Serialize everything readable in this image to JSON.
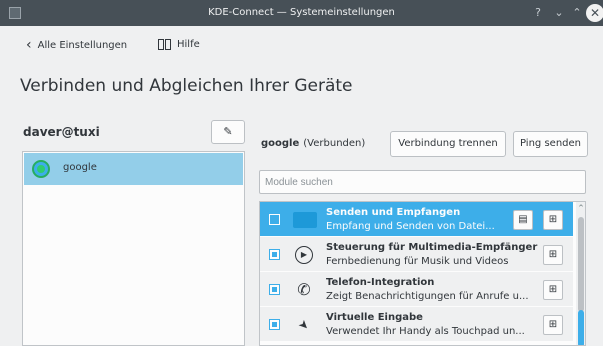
{
  "window": {
    "title": "KDE-Connect — Systemeinstellungen",
    "help_glyph": "?",
    "minimize_glyph": "⌄",
    "maximize_glyph": "⌃",
    "close_glyph": "✕"
  },
  "toolbar": {
    "back_label": "Alle Einstellungen",
    "help_label": "Hilfe"
  },
  "page": {
    "heading": "Verbinden und Abgleichen Ihrer Geräte"
  },
  "left": {
    "host_name": "daver@tuxi",
    "edit_glyph": "✎",
    "devices": [
      {
        "label": "google"
      }
    ]
  },
  "right": {
    "device_name": "google",
    "device_state": "(Verbunden)",
    "disconnect_label": "Verbindung trennen",
    "ping_label": "Ping senden",
    "search_placeholder": "Module suchen",
    "plugins": [
      {
        "title": "Senden und Empfangen",
        "desc": "Empfang und Senden von Datei...",
        "enabled": false,
        "icon": "folder-icon"
      },
      {
        "title": "Steuerung für Multimedia-Empfänger",
        "desc": "Fernbedienung für Musik und Videos",
        "enabled": true,
        "icon": "play-icon",
        "icon_glyph": "▶"
      },
      {
        "title": "Telefon-Integration",
        "desc": "Zeigt Benachrichtigungen für Anrufe u...",
        "enabled": true,
        "icon": "phone-icon",
        "icon_glyph": "✆"
      },
      {
        "title": "Virtuelle Eingabe",
        "desc": "Verwendet Ihr Handy als Touchpad un...",
        "enabled": true,
        "icon": "pointer-icon",
        "icon_glyph": "➤"
      }
    ],
    "settings_glyph": "⊞",
    "about_glyph": "▤",
    "scroll_up_glyph": "⌃"
  },
  "colors": {
    "accent": "#3daee9",
    "titlebar": "#475057",
    "background": "#eff0f1",
    "selection_light": "#93cee9"
  }
}
